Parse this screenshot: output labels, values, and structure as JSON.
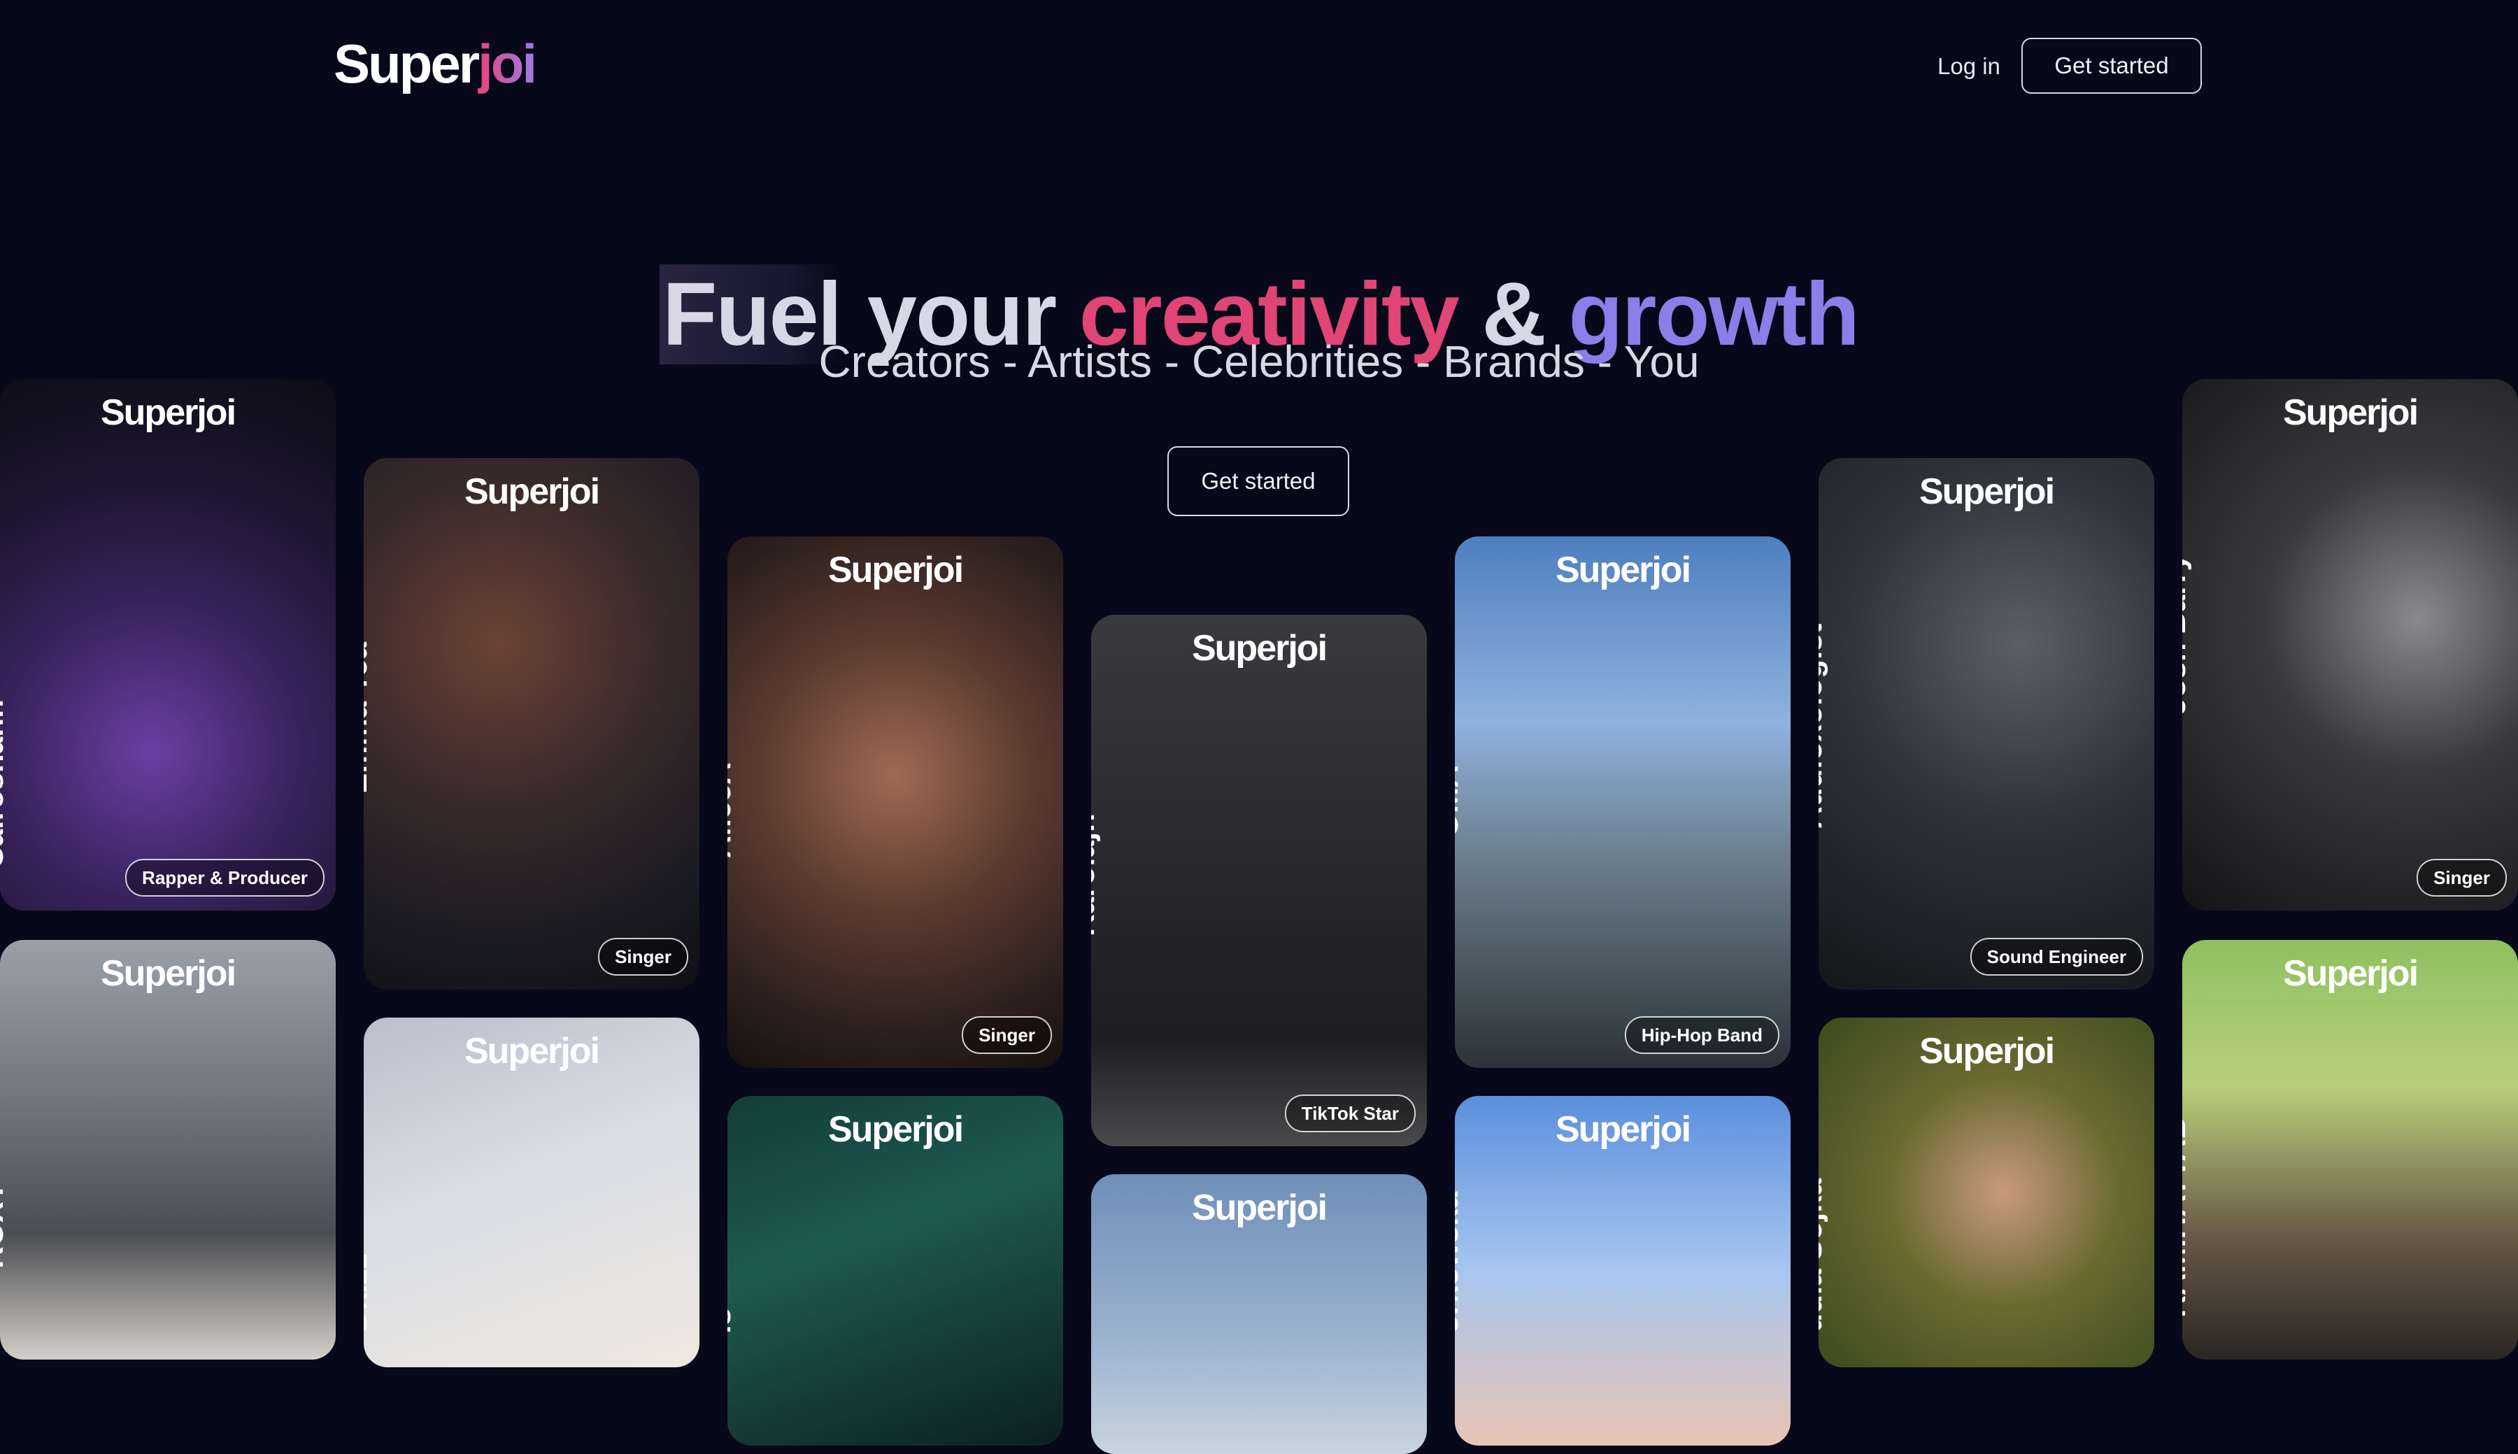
{
  "header": {
    "logo_part1": "Super",
    "logo_part2": "joi",
    "login_label": "Log in",
    "get_started_label": "Get started"
  },
  "hero": {
    "word1": "Fuel",
    "word2": "your",
    "word3": "creativity",
    "word4": "&",
    "word5": "growth",
    "subtitle": "Creators - Artists - Celebrities - Brands - You",
    "cta_label": "Get started"
  },
  "colors": {
    "background": "#07081a",
    "accent_pink": "#e04575",
    "accent_violet": "#8a7fe8"
  },
  "cards": [
    {
      "brand": "Superjoi",
      "name": "Cairoshann",
      "tag": "Rapper & Producer"
    },
    {
      "brand": "Superjoi",
      "name": "ROXY",
      "tag": ""
    },
    {
      "brand": "Superjoi",
      "name": "Emma Tea",
      "tag": "Singer"
    },
    {
      "brand": "Superjoi",
      "name": "Dkizz",
      "tag": ""
    },
    {
      "brand": "Superjoi",
      "name": "AliceA",
      "tag": "Singer"
    },
    {
      "brand": "Superjoi",
      "name": "ls",
      "tag": ""
    },
    {
      "brand": "Superjoi",
      "name": "Karolajn",
      "tag": "TikTok Star"
    },
    {
      "brand": "Superjoi",
      "name": "",
      "tag": ""
    },
    {
      "brand": "Superjoi",
      "name": "OMA",
      "tag": "Hip-Hop Band"
    },
    {
      "brand": "Superjoi",
      "name": "orkowska",
      "tag": ""
    },
    {
      "brand": "Superjoi",
      "name": "Audioxologist",
      "tag": "Sound Engineer"
    },
    {
      "brand": "Superjoi",
      "name": "udia Sojka",
      "tag": ""
    },
    {
      "brand": "Superjoi",
      "name": "Josh Barry",
      "tag": "Singer"
    },
    {
      "brand": "Superjoi",
      "name": "RAMIHATTAB*",
      "tag": ""
    }
  ]
}
